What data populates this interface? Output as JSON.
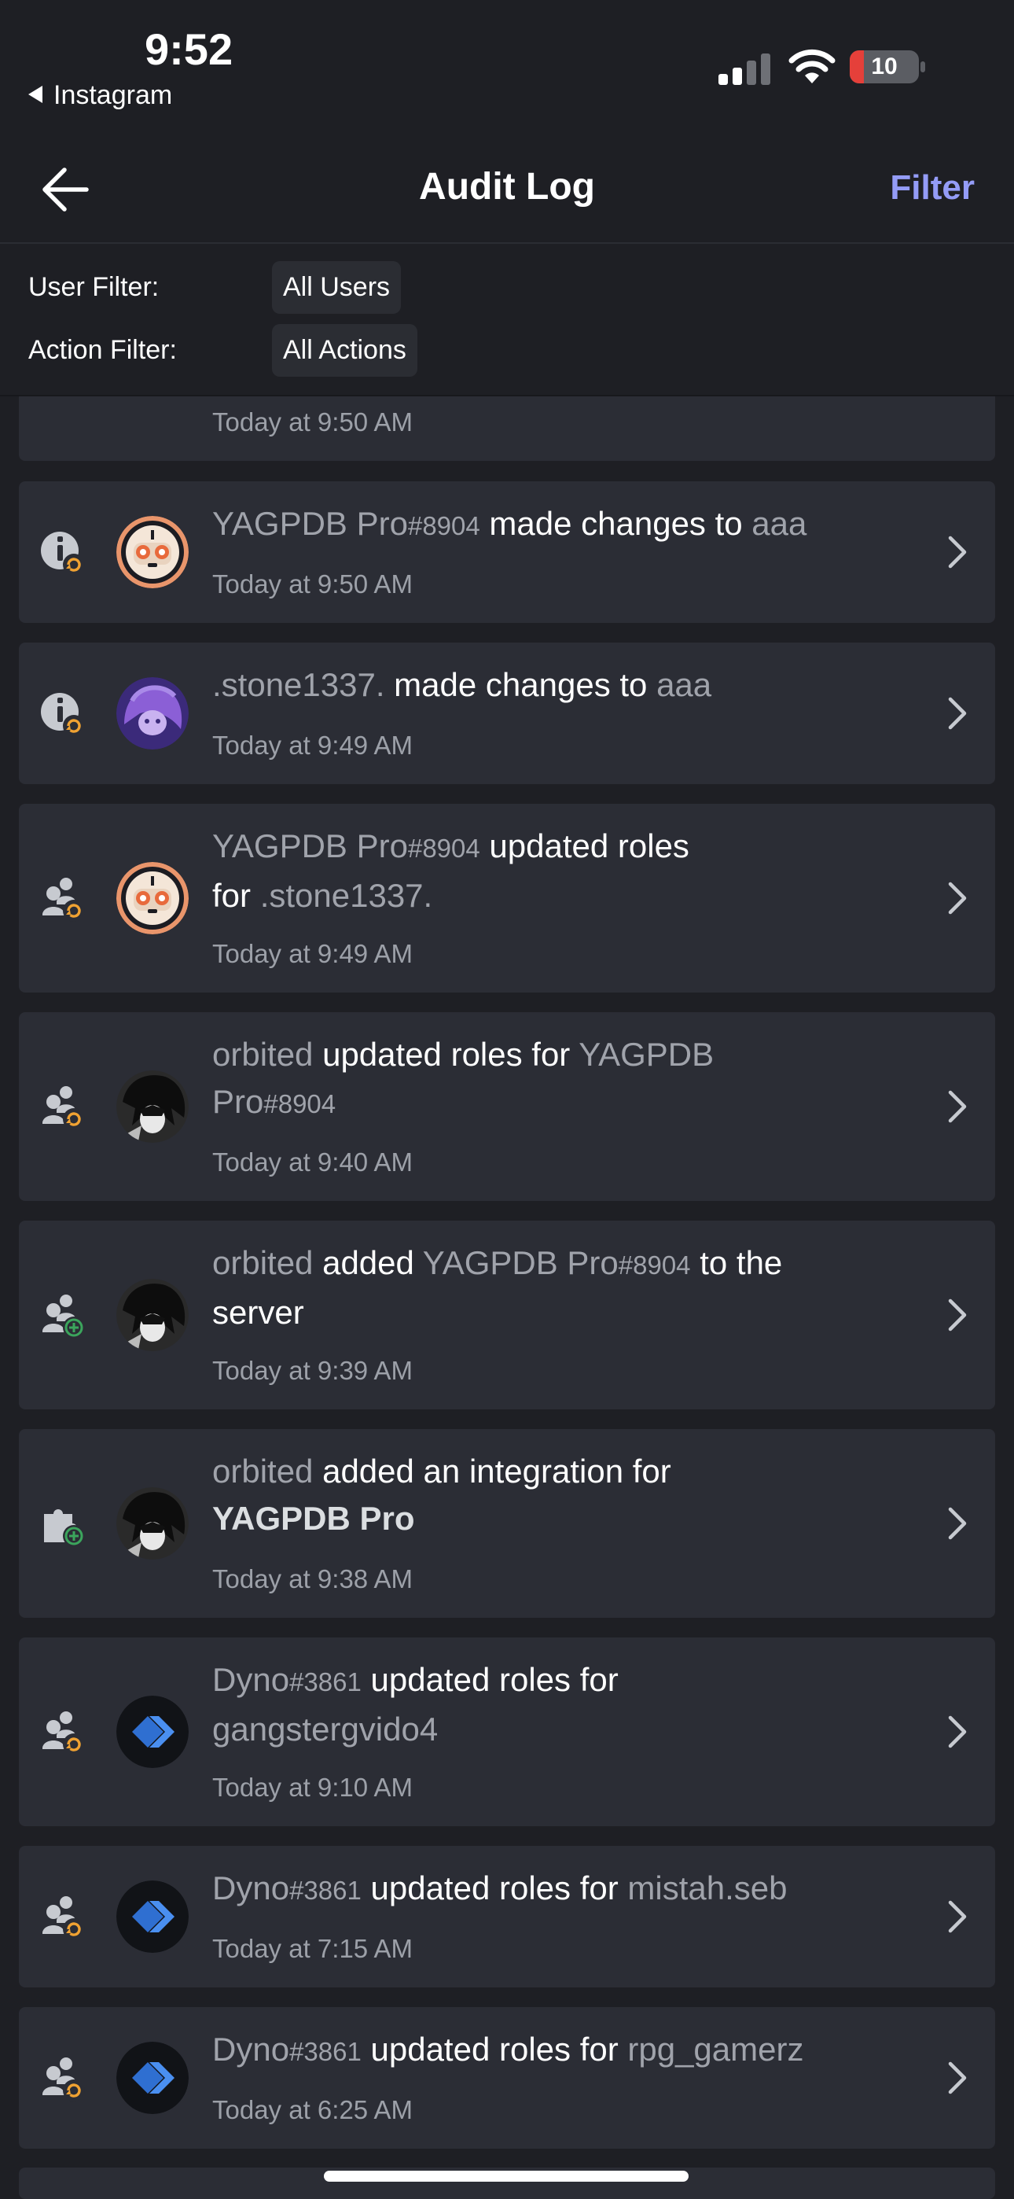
{
  "status_bar": {
    "time": "9:52",
    "back_app": "Instagram",
    "battery": "10"
  },
  "nav": {
    "title": "Audit Log",
    "filter_label": "Filter"
  },
  "filters": {
    "user_label": "User Filter:",
    "user_value": "All Users",
    "action_label": "Action Filter:",
    "action_value": "All Actions"
  },
  "entries": [
    {
      "time": "Today at 9:50 AM"
    },
    {
      "actor": "YAGPDB Pro",
      "actor_disc": "#8904",
      "verb": " made changes to ",
      "target": "aaa",
      "time": "Today at 9:50 AM",
      "icon": "info-update-icon",
      "avatar": "yagpdb-avatar"
    },
    {
      "actor": ".stone1337.",
      "verb": " made changes to ",
      "target": "aaa",
      "time": "Today at 9:49 AM",
      "icon": "info-update-icon",
      "avatar": "stone-avatar"
    },
    {
      "actor": "YAGPDB Pro",
      "actor_disc": "#8904",
      "verb": " updated roles",
      "line2_pre": "for ",
      "target": ".stone1337.",
      "time": "Today at 9:49 AM",
      "icon": "member-update-icon",
      "avatar": "yagpdb-avatar"
    },
    {
      "actor": "orbited",
      "verb": " updated roles for ",
      "target_line1": "YAGPDB",
      "target_line2": "Pro",
      "target_disc": "#8904",
      "time": "Today at 9:40 AM",
      "icon": "member-update-icon",
      "avatar": "orbited-avatar"
    },
    {
      "actor": "orbited",
      "verb": " added ",
      "target": "YAGPDB Pro",
      "target_disc": "#8904",
      "suffix": " to the",
      "line2": "server",
      "time": "Today at 9:39 AM",
      "icon": "member-add-icon",
      "avatar": "orbited-avatar"
    },
    {
      "actor": "orbited",
      "verb": " added an integration for",
      "target": "YAGPDB Pro",
      "time": "Today at 9:38 AM",
      "icon": "integration-add-icon",
      "avatar": "orbited-avatar"
    },
    {
      "actor": "Dyno",
      "actor_disc": "#3861",
      "verb": " updated roles for",
      "target": "gangstergvido4",
      "time": "Today at 9:10 AM",
      "icon": "member-update-icon",
      "avatar": "dyno-avatar"
    },
    {
      "actor": "Dyno",
      "actor_disc": "#3861",
      "verb": " updated roles for ",
      "target": "mistah.seb",
      "time": "Today at 7:15 AM",
      "icon": "member-update-icon",
      "avatar": "dyno-avatar"
    },
    {
      "actor": "Dyno",
      "actor_disc": "#3861",
      "verb": " updated roles for ",
      "target": "rpg_gamerz",
      "time": "Today at 6:25 AM",
      "icon": "member-update-icon",
      "avatar": "dyno-avatar"
    }
  ],
  "colors": {
    "background": "#1e1f24",
    "card": "#2b2d35",
    "accent": "#949cf7",
    "update_orange": "#f0a232",
    "add_green": "#3ba55c",
    "dyno_blue": "#3a7bd5"
  }
}
